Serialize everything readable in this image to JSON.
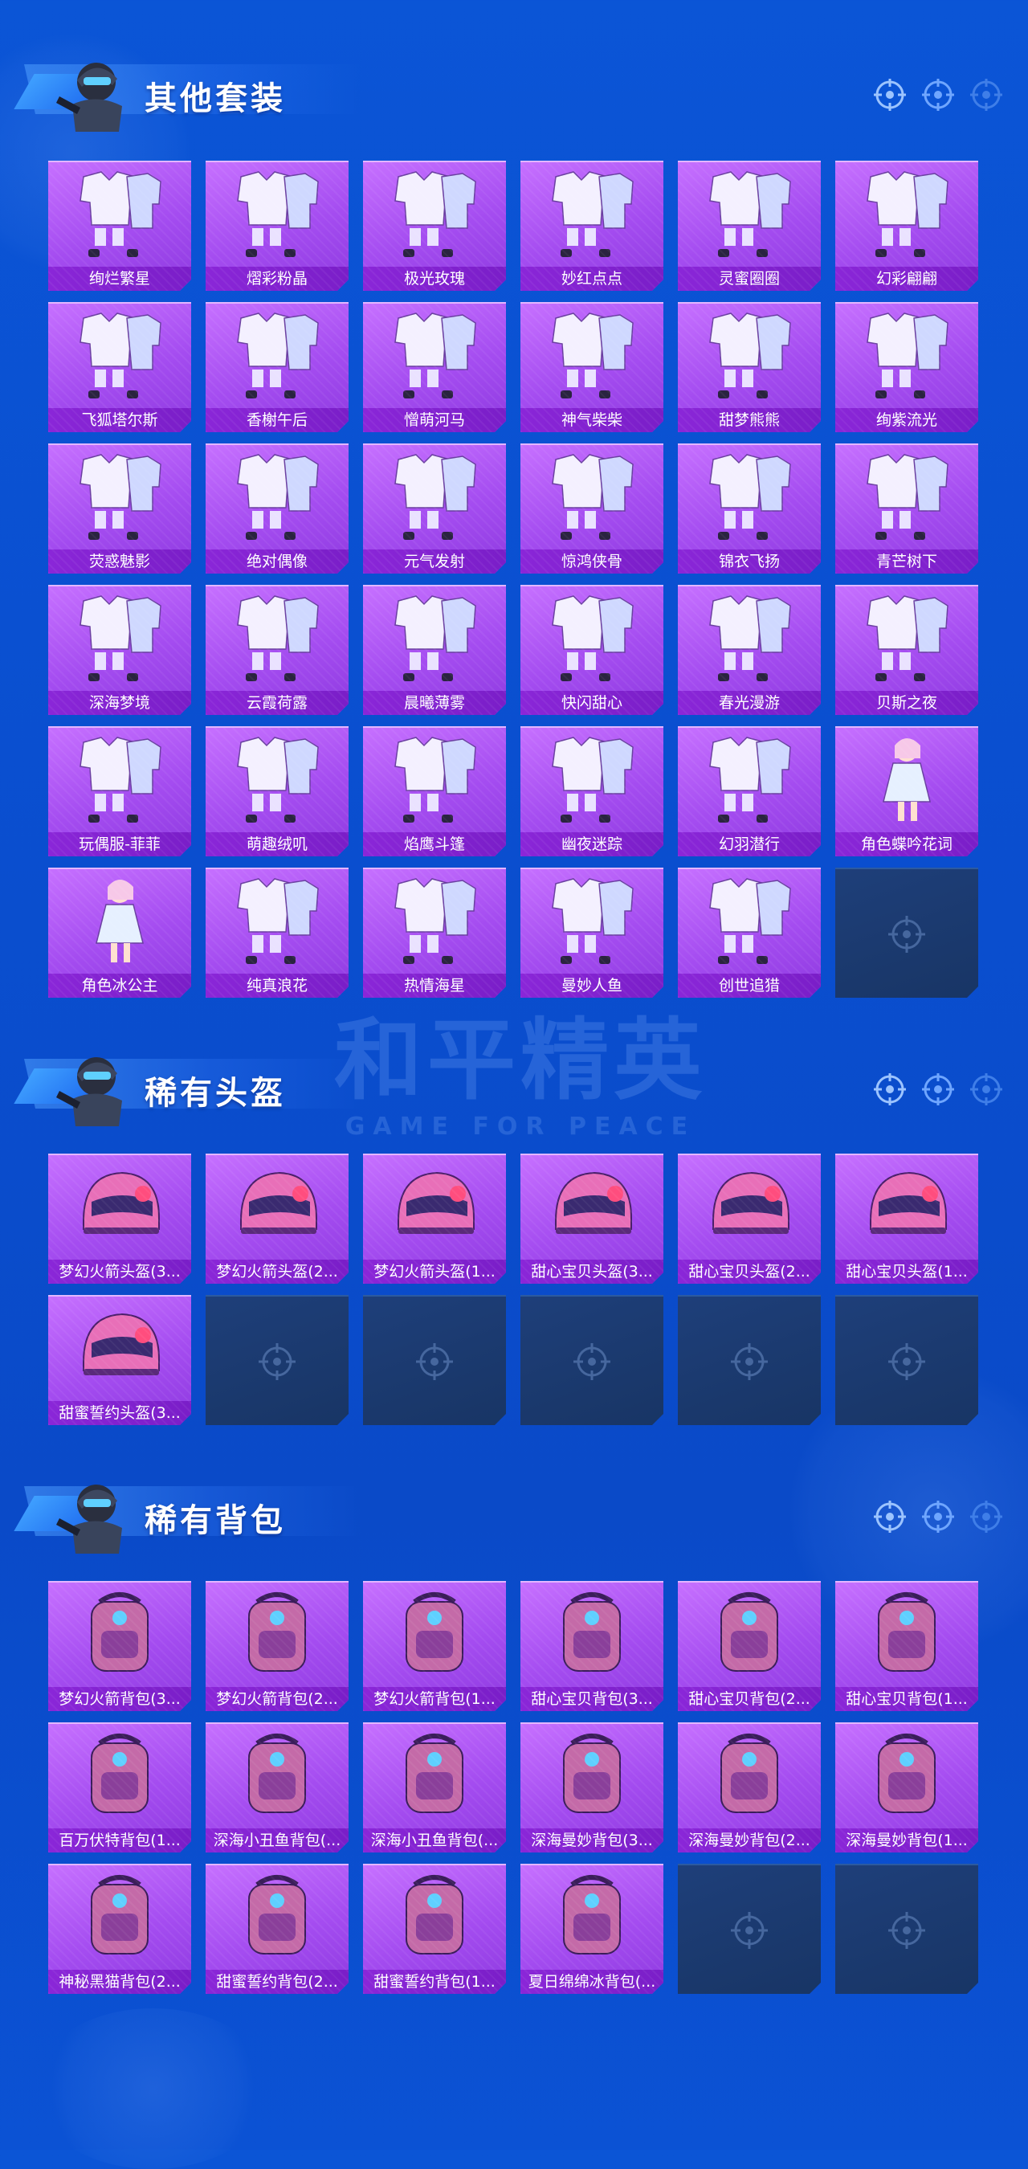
{
  "watermark": {
    "cn": "和平精英",
    "en": "GAME FOR PEACE"
  },
  "sections": [
    {
      "title": "其他套装",
      "items": [
        {
          "name": "绚烂繁星",
          "icon": "outfit-icon"
        },
        {
          "name": "熠彩粉晶",
          "icon": "outfit-icon"
        },
        {
          "name": "极光玫瑰",
          "icon": "outfit-icon"
        },
        {
          "name": "妙红点点",
          "icon": "outfit-icon"
        },
        {
          "name": "灵蜜圈圈",
          "icon": "outfit-icon"
        },
        {
          "name": "幻彩翩翩",
          "icon": "outfit-icon"
        },
        {
          "name": "飞狐塔尔斯",
          "icon": "outfit-icon"
        },
        {
          "name": "香榭午后",
          "icon": "outfit-icon"
        },
        {
          "name": "憎萌河马",
          "icon": "outfit-icon"
        },
        {
          "name": "神气柴柴",
          "icon": "outfit-icon"
        },
        {
          "name": "甜梦熊熊",
          "icon": "outfit-icon"
        },
        {
          "name": "绚紫流光",
          "icon": "outfit-icon"
        },
        {
          "name": "荧惑魅影",
          "icon": "outfit-icon"
        },
        {
          "name": "绝对偶像",
          "icon": "outfit-icon"
        },
        {
          "name": "元气发射",
          "icon": "outfit-icon"
        },
        {
          "name": "惊鸿侠骨",
          "icon": "outfit-icon"
        },
        {
          "name": "锦衣飞扬",
          "icon": "outfit-icon"
        },
        {
          "name": "青芒树下",
          "icon": "outfit-icon"
        },
        {
          "name": "深海梦境",
          "icon": "outfit-icon"
        },
        {
          "name": "云霞荷露",
          "icon": "outfit-icon"
        },
        {
          "name": "晨曦薄雾",
          "icon": "outfit-icon"
        },
        {
          "name": "快闪甜心",
          "icon": "outfit-icon"
        },
        {
          "name": "春光漫游",
          "icon": "outfit-icon"
        },
        {
          "name": "贝斯之夜",
          "icon": "outfit-icon"
        },
        {
          "name": "玩偶服-菲菲",
          "icon": "outfit-icon"
        },
        {
          "name": "萌趣绒叽",
          "icon": "outfit-icon"
        },
        {
          "name": "焰鹰斗篷",
          "icon": "outfit-icon"
        },
        {
          "name": "幽夜迷踪",
          "icon": "outfit-icon"
        },
        {
          "name": "幻羽潜行",
          "icon": "outfit-icon"
        },
        {
          "name": "角色蝶吟花词",
          "icon": "character-icon"
        },
        {
          "name": "角色冰公主",
          "icon": "character-icon"
        },
        {
          "name": "纯真浪花",
          "icon": "outfit-icon"
        },
        {
          "name": "热情海星",
          "icon": "outfit-icon"
        },
        {
          "name": "曼妙人鱼",
          "icon": "outfit-icon"
        },
        {
          "name": "创世追猎",
          "icon": "outfit-icon"
        },
        {
          "empty": true
        }
      ]
    },
    {
      "title": "稀有头盔",
      "items": [
        {
          "name": "梦幻火箭头盔(3...",
          "icon": "helmet-icon"
        },
        {
          "name": "梦幻火箭头盔(2...",
          "icon": "helmet-icon"
        },
        {
          "name": "梦幻火箭头盔(1...",
          "icon": "helmet-icon"
        },
        {
          "name": "甜心宝贝头盔(3...",
          "icon": "helmet-icon"
        },
        {
          "name": "甜心宝贝头盔(2...",
          "icon": "helmet-icon"
        },
        {
          "name": "甜心宝贝头盔(1...",
          "icon": "helmet-icon"
        },
        {
          "name": "甜蜜誓约头盔(3...",
          "icon": "helmet-icon"
        },
        {
          "empty": true
        },
        {
          "empty": true
        },
        {
          "empty": true
        },
        {
          "empty": true
        },
        {
          "empty": true
        }
      ]
    },
    {
      "title": "稀有背包",
      "items": [
        {
          "name": "梦幻火箭背包(3...",
          "icon": "backpack-icon"
        },
        {
          "name": "梦幻火箭背包(2...",
          "icon": "backpack-icon"
        },
        {
          "name": "梦幻火箭背包(1...",
          "icon": "backpack-icon"
        },
        {
          "name": "甜心宝贝背包(3...",
          "icon": "backpack-icon"
        },
        {
          "name": "甜心宝贝背包(2...",
          "icon": "backpack-icon"
        },
        {
          "name": "甜心宝贝背包(1...",
          "icon": "backpack-icon"
        },
        {
          "name": "百万伏特背包(1...",
          "icon": "backpack-icon"
        },
        {
          "name": "深海小丑鱼背包(...",
          "icon": "backpack-icon"
        },
        {
          "name": "深海小丑鱼背包(...",
          "icon": "backpack-icon"
        },
        {
          "name": "深海曼妙背包(3...",
          "icon": "backpack-icon"
        },
        {
          "name": "深海曼妙背包(2...",
          "icon": "backpack-icon"
        },
        {
          "name": "深海曼妙背包(1...",
          "icon": "backpack-icon"
        },
        {
          "name": "神秘黑猫背包(2...",
          "icon": "backpack-icon"
        },
        {
          "name": "甜蜜誓约背包(2...",
          "icon": "backpack-icon"
        },
        {
          "name": "甜蜜誓约背包(1...",
          "icon": "backpack-icon"
        },
        {
          "name": "夏日绵绵冰背包(...",
          "icon": "backpack-icon"
        },
        {
          "empty": true
        },
        {
          "empty": true
        }
      ]
    }
  ],
  "colors": {
    "background": "#0a4fd0",
    "card_top": "#c670ff",
    "card_bottom": "#8e3ae0",
    "label_bar": "#8a26d8",
    "empty_card": "#1e3f7a"
  }
}
